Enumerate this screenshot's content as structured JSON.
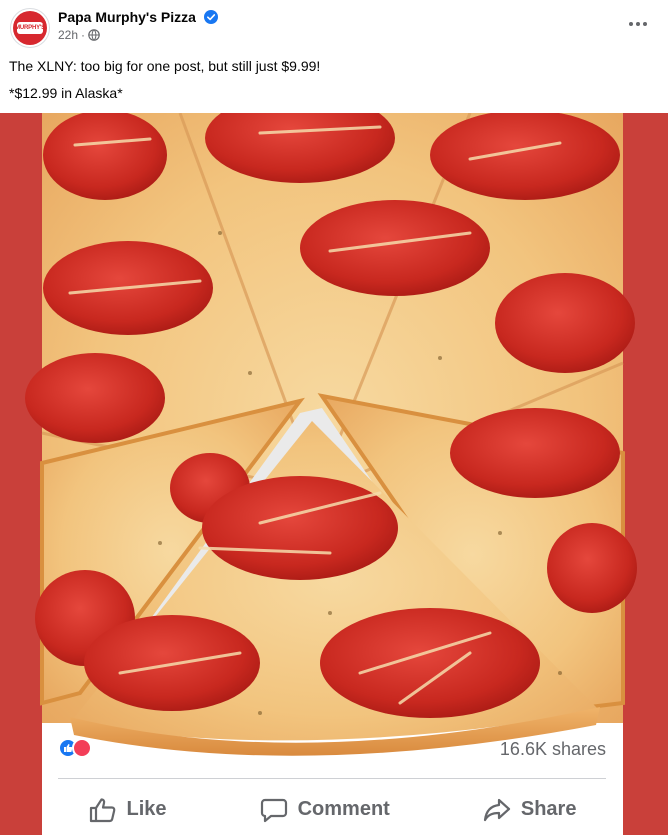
{
  "post": {
    "page_name": "Papa Murphy's Pizza",
    "time": "22h",
    "separator": "·",
    "caption_line1": "The XLNY: too big for one post, but still just $9.99!",
    "caption_line2": "*$12.99 in Alaska*",
    "avatar_text": "MURPHY'S"
  },
  "engagement": {
    "shares": "16.6K shares"
  },
  "actions": {
    "like": "Like",
    "comment": "Comment",
    "share": "Share"
  },
  "icons": {
    "verified": "verified-badge-icon",
    "privacy": "globe-icon",
    "more": "more-options-icon",
    "like": "thumbs-up-icon",
    "comment": "comment-bubble-icon",
    "share": "share-arrow-icon"
  },
  "colors": {
    "brand_red": "#d7282f",
    "background_red": "#c9403a",
    "facebook_blue": "#1877f2",
    "text_primary": "#050505",
    "text_secondary": "#65676b"
  }
}
